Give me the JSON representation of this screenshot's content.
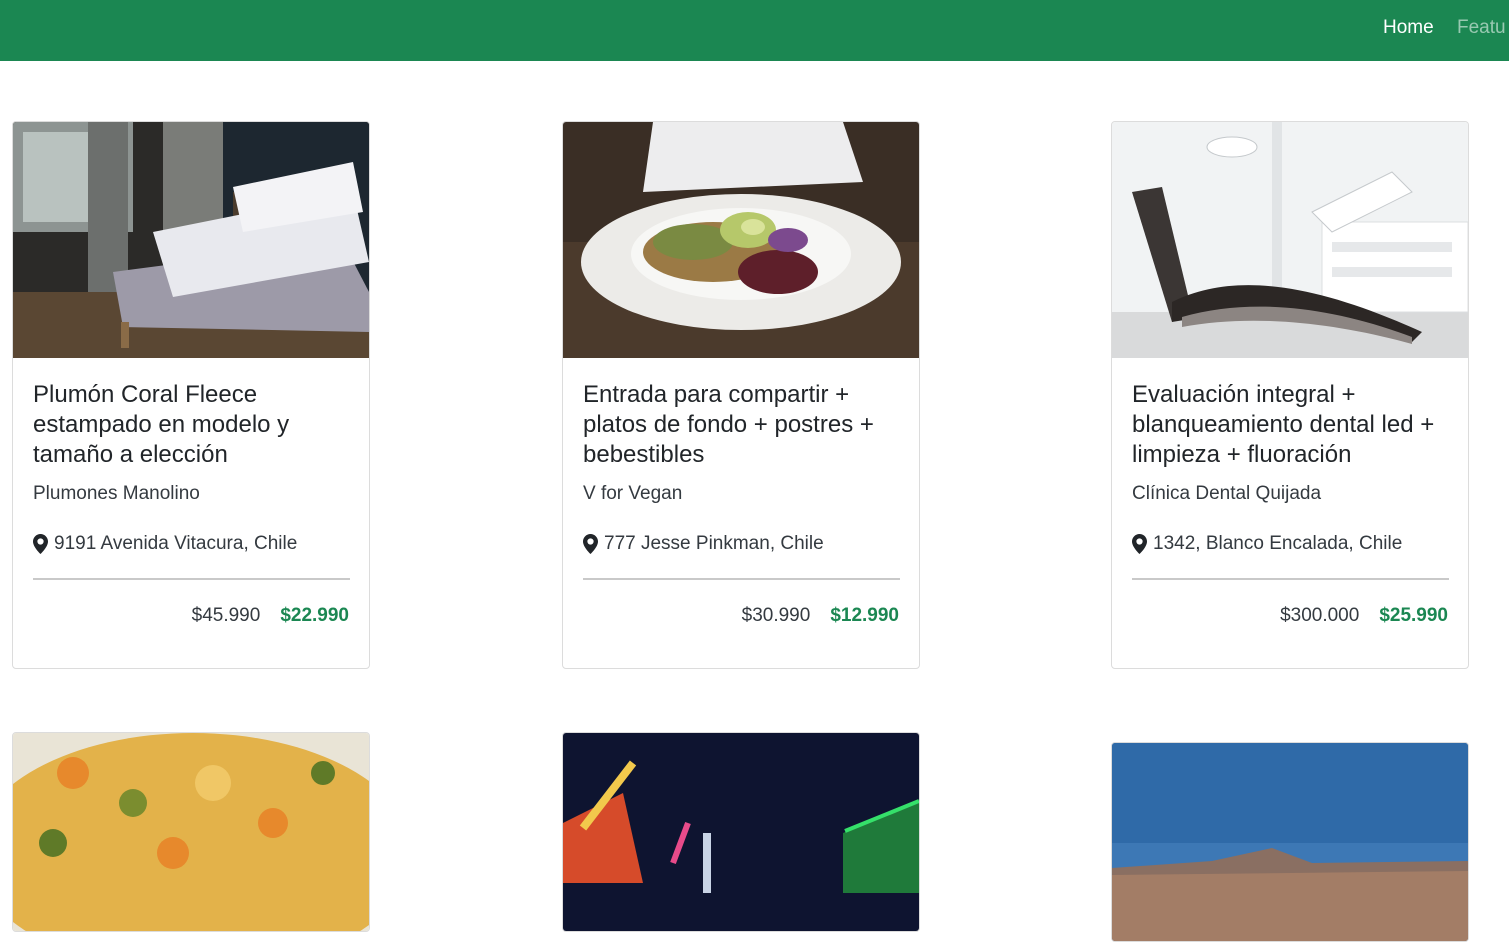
{
  "nav": {
    "home": "Home",
    "features": "Featu"
  },
  "deals": [
    {
      "title": "Plumón Coral Fleece estampado en modelo y tamaño a elección",
      "merchant": "Plumones Manolino",
      "location": "9191 Avenida Vitacura, Chile",
      "old_price": "$45.990",
      "new_price": "$22.990"
    },
    {
      "title": "Entrada para compartir + platos de fondo + postres + bebestibles",
      "merchant": "V for Vegan",
      "location": "777 Jesse Pinkman, Chile",
      "old_price": "$30.990",
      "new_price": "$12.990"
    },
    {
      "title": "Evaluación integral + blanqueamiento dental led + limpieza + fluoración",
      "merchant": "Clínica Dental Quijada",
      "location": "1342, Blanco Encalada, Chile",
      "old_price": "$300.000",
      "new_price": "$25.990"
    }
  ],
  "colors": {
    "brand": "#1b8752",
    "text": "#212529",
    "muted": "#343a40",
    "border": "#dcdcdc"
  },
  "icons": {
    "location": "map-marker-icon"
  }
}
